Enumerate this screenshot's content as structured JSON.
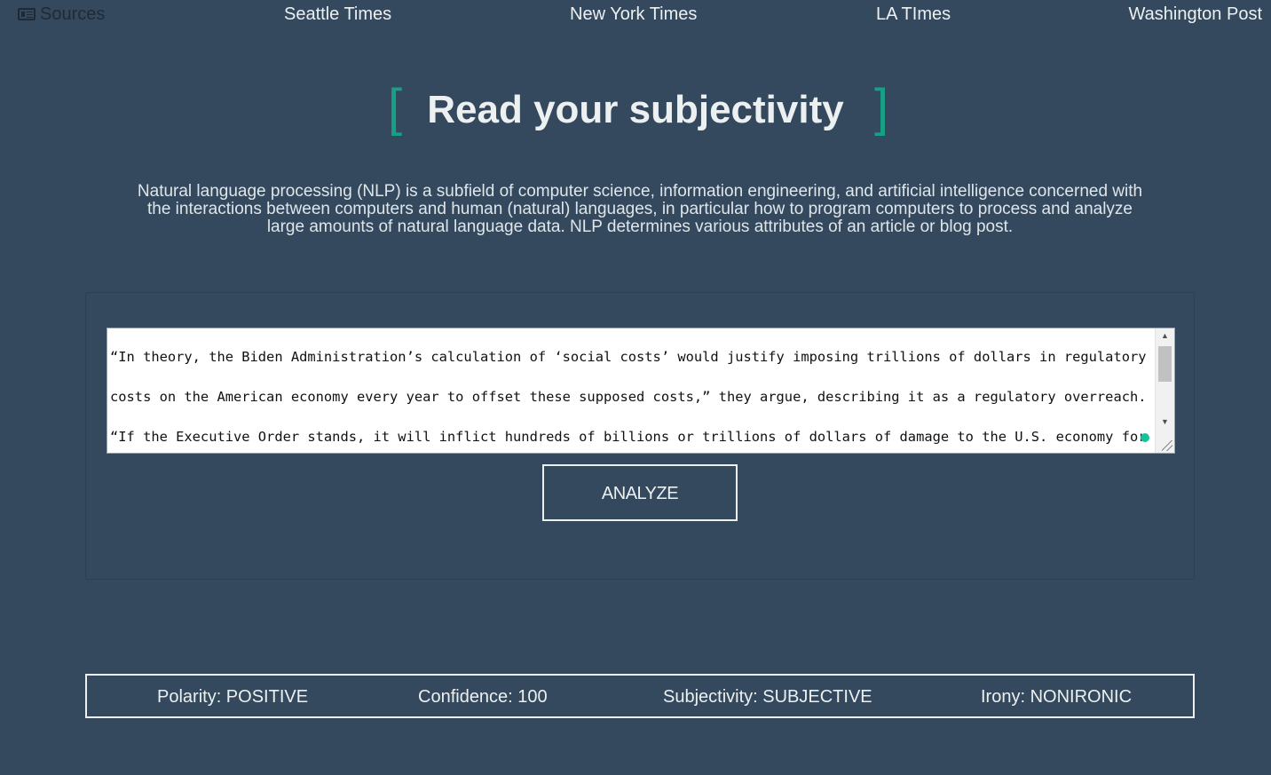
{
  "nav": {
    "sources_label": "Sources",
    "sources_icon": "newspaper-icon",
    "links": [
      "Seattle Times",
      "New York Times",
      "LA TImes",
      "Washington Post"
    ]
  },
  "hero": {
    "bracket_open": "[",
    "title": "Read your subjectivity",
    "bracket_close": "]",
    "intro": "Natural language processing (NLP) is a subfield of computer science, information engineering, and artificial intelligence concerned with the interactions between computers and human (natural) languages, in particular how to program computers to process and analyze large amounts of natural language data. NLP determines various attributes of an article or blog post."
  },
  "analyzer": {
    "text_lines": [
      "“In theory, the Biden Administration’s calculation of ‘social costs’ would justify imposing trillions of dollars in regulatory",
      "costs on the American economy every year to offset these supposed costs,” they argue, describing it as a regulatory overreach.",
      "“If the Executive Order stands, it will inflict hundreds of billions or trillions of dollars of damage to the U.S. economy for"
    ],
    "button_label": "ANALYZE"
  },
  "results": {
    "polarity": "Polarity: POSITIVE",
    "confidence": "Confidence: 100",
    "subjectivity": "Subjectivity: SUBJECTIVE",
    "irony": "Irony: NONIRONIC"
  },
  "colors": {
    "background": "#34495e",
    "accent": "#16a085",
    "text": "#ecf0f1"
  }
}
